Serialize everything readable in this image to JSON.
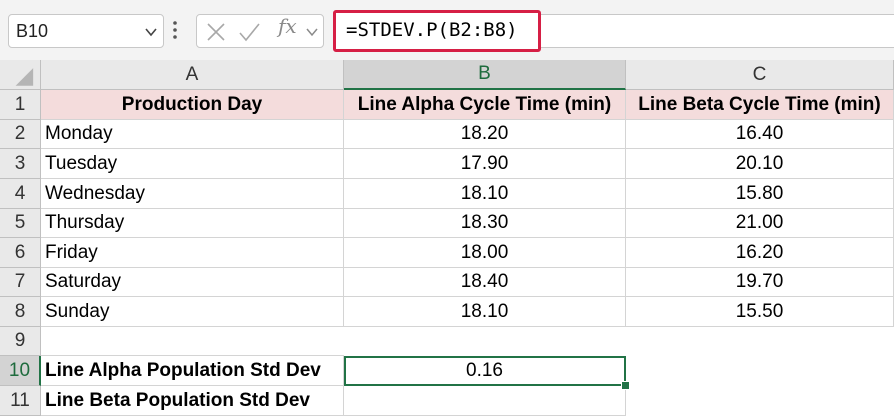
{
  "name_box": {
    "value": "B10"
  },
  "formula_bar": {
    "formula": "=STDEV.P(B2:B8)",
    "fx_label": "fx"
  },
  "column_headers": [
    "A",
    "B",
    "C"
  ],
  "row_headers": [
    "1",
    "2",
    "3",
    "4",
    "5",
    "6",
    "7",
    "8",
    "9",
    "10",
    "11"
  ],
  "selected": {
    "column": "B",
    "row": "10"
  },
  "header_row": [
    "Production Day",
    "Line Alpha Cycle Time (min)",
    "Line Beta Cycle Time (min)"
  ],
  "data_rows": [
    [
      "Monday",
      "18.20",
      "16.40"
    ],
    [
      "Tuesday",
      "17.90",
      "20.10"
    ],
    [
      "Wednesday",
      "18.10",
      "15.80"
    ],
    [
      "Thursday",
      "18.30",
      "21.00"
    ],
    [
      "Friday",
      "18.00",
      "16.20"
    ],
    [
      "Saturday",
      "18.40",
      "19.70"
    ],
    [
      "Sunday",
      "18.10",
      "15.50"
    ]
  ],
  "summary_rows": [
    {
      "label": "Line Alpha Population Std Dev",
      "value": "0.16"
    },
    {
      "label": "Line Beta Population Std Dev",
      "value": ""
    }
  ],
  "colors": {
    "accent_red": "#d61f45",
    "excel_green": "#217346",
    "header_fill": "#f4dcdc"
  }
}
